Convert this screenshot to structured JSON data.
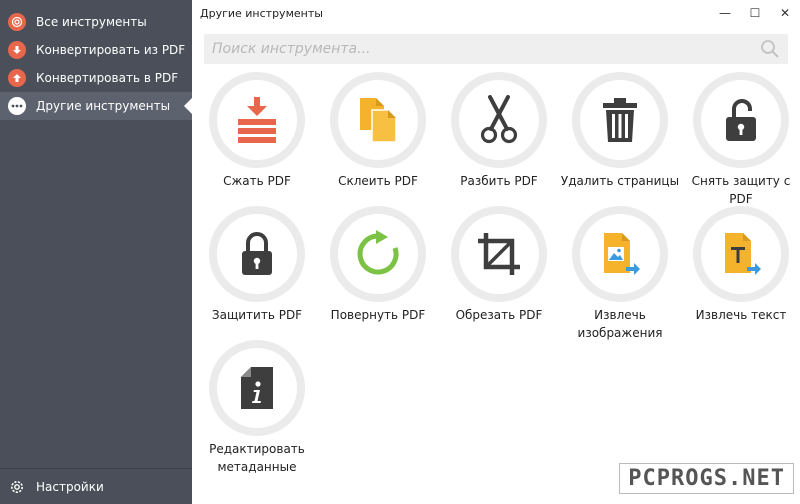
{
  "sidebar": {
    "items": [
      {
        "label": "Все инструменты",
        "icon": "target-icon",
        "color": "#e8674c"
      },
      {
        "label": "Конвертировать из PDF",
        "icon": "arrow-down-icon",
        "color": "#e8674c"
      },
      {
        "label": "Конвертировать в PDF",
        "icon": "arrow-up-icon",
        "color": "#e8674c"
      },
      {
        "label": "Другие инструменты",
        "icon": "more-dots-icon",
        "color": "#ffffff"
      }
    ],
    "settings_label": "Настройки"
  },
  "window": {
    "title": "Другие инструменты",
    "minimize": "—",
    "maximize": "☐",
    "close": "✕"
  },
  "search": {
    "placeholder": "Поиск инструмента...",
    "value": ""
  },
  "tools": [
    {
      "label": "Сжать PDF",
      "icon": "compress-icon"
    },
    {
      "label": "Склеить PDF",
      "icon": "merge-icon"
    },
    {
      "label": "Разбить PDF",
      "icon": "scissors-icon"
    },
    {
      "label": "Удалить страницы",
      "icon": "trash-icon"
    },
    {
      "label": "Снять защиту с PDF",
      "icon": "unlock-icon"
    },
    {
      "label": "Защитить PDF",
      "icon": "lock-icon"
    },
    {
      "label": "Повернуть PDF",
      "icon": "rotate-icon"
    },
    {
      "label": "Обрезать PDF",
      "icon": "crop-icon"
    },
    {
      "label": "Извлечь изображения",
      "icon": "extract-image-icon"
    },
    {
      "label": "Извлечь текст",
      "icon": "extract-text-icon"
    },
    {
      "label": "Редактировать метаданные",
      "icon": "metadata-icon"
    }
  ],
  "watermark": "PCPROGS.NET",
  "colors": {
    "sidebar_bg": "#4a4f59",
    "accent_red": "#e8674c",
    "accent_yellow": "#f5b32b",
    "accent_green": "#7cc245",
    "icon_dark": "#3e3e3e",
    "arrow_blue": "#3b9be0"
  }
}
